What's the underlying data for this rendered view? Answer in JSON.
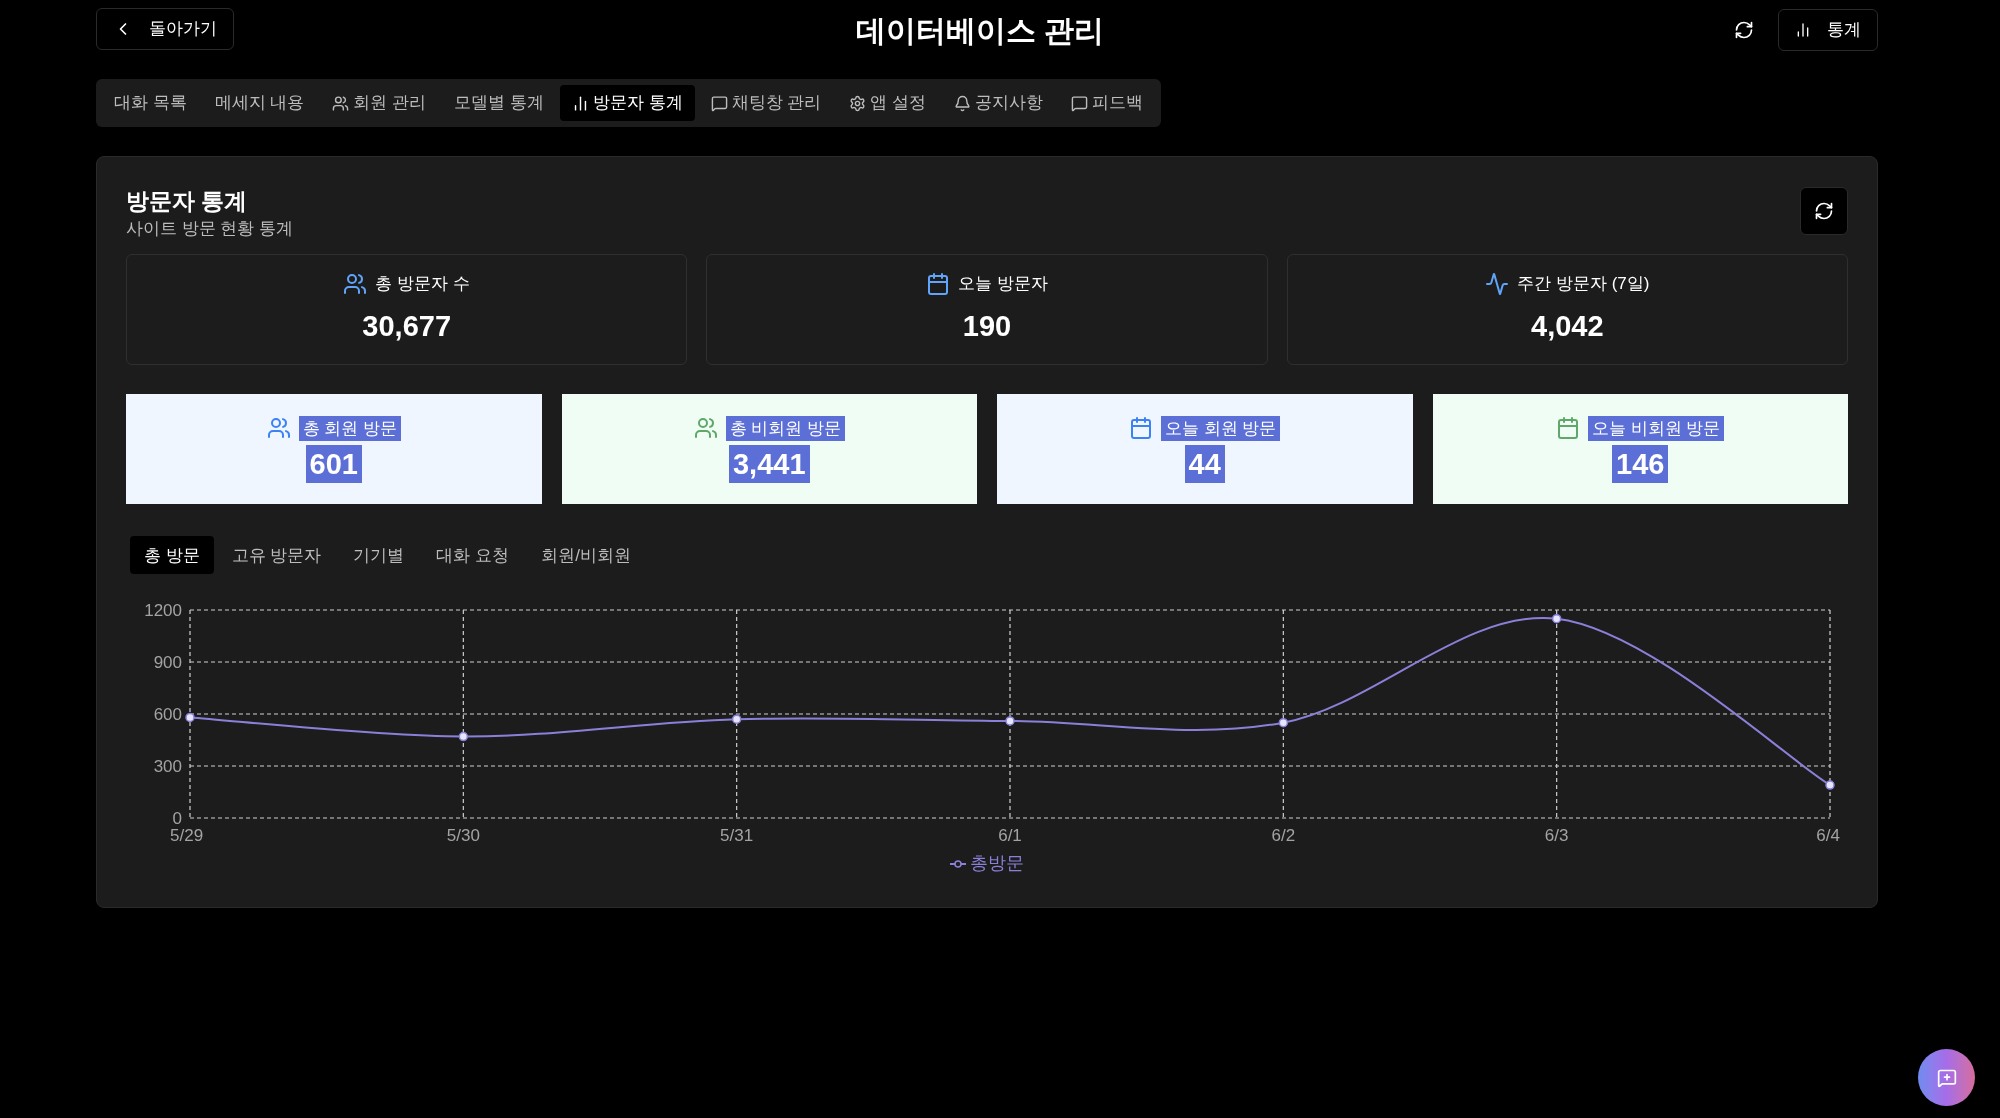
{
  "header": {
    "back_button": "돌아가기",
    "title": "데이터베이스 관리",
    "stats_button": "통계"
  },
  "tabs": [
    {
      "label": "대화 목록",
      "selected": false
    },
    {
      "label": "메세지 내용",
      "selected": false
    },
    {
      "label": "회원 관리",
      "selected": false
    },
    {
      "label": "모델별 통계",
      "selected": false
    },
    {
      "label": "방문자 통계",
      "selected": true
    },
    {
      "label": "채팅창 관리",
      "selected": false
    },
    {
      "label": "앱 설정",
      "selected": false
    },
    {
      "label": "공지사항",
      "selected": false
    },
    {
      "label": "피드백",
      "selected": false
    }
  ],
  "panel": {
    "title": "방문자 통계",
    "subtitle": "사이트 방문 현황 통계"
  },
  "summary_cards": [
    {
      "label": "총 방문자 수",
      "value": "30,677"
    },
    {
      "label": "오늘 방문자",
      "value": "190"
    },
    {
      "label": "주간 방문자 (7일)",
      "value": "4,042"
    }
  ],
  "visit_cards": [
    {
      "kind": "member",
      "label": "총 회원 방문",
      "value": "601",
      "highlighted": true
    },
    {
      "kind": "guest",
      "label": "총 비회원 방문",
      "value": "3,441",
      "highlighted": true
    },
    {
      "kind": "member",
      "label": "오늘 회원 방문",
      "value": "44",
      "highlighted": true
    },
    {
      "kind": "guest",
      "label": "오늘 비회원 방문",
      "value": "146",
      "highlighted": true
    }
  ],
  "chart_tabs": [
    {
      "label": "총 방문",
      "selected": true
    },
    {
      "label": "고유 방문자",
      "selected": false
    },
    {
      "label": "기기별",
      "selected": false
    },
    {
      "label": "대화 요청",
      "selected": false
    },
    {
      "label": "회원/비회원",
      "selected": false
    }
  ],
  "chart_data": {
    "type": "line",
    "categories": [
      "5/29",
      "5/30",
      "5/31",
      "6/1",
      "6/2",
      "6/3",
      "6/4"
    ],
    "series": [
      {
        "name": "총방문",
        "color": "#8b80d9",
        "marker": true,
        "values": [
          580,
          470,
          570,
          560,
          550,
          1150,
          190
        ]
      }
    ],
    "ylim": [
      0,
      1200
    ],
    "yticks": [
      0,
      300,
      600,
      900,
      1200
    ],
    "grid": true
  }
}
